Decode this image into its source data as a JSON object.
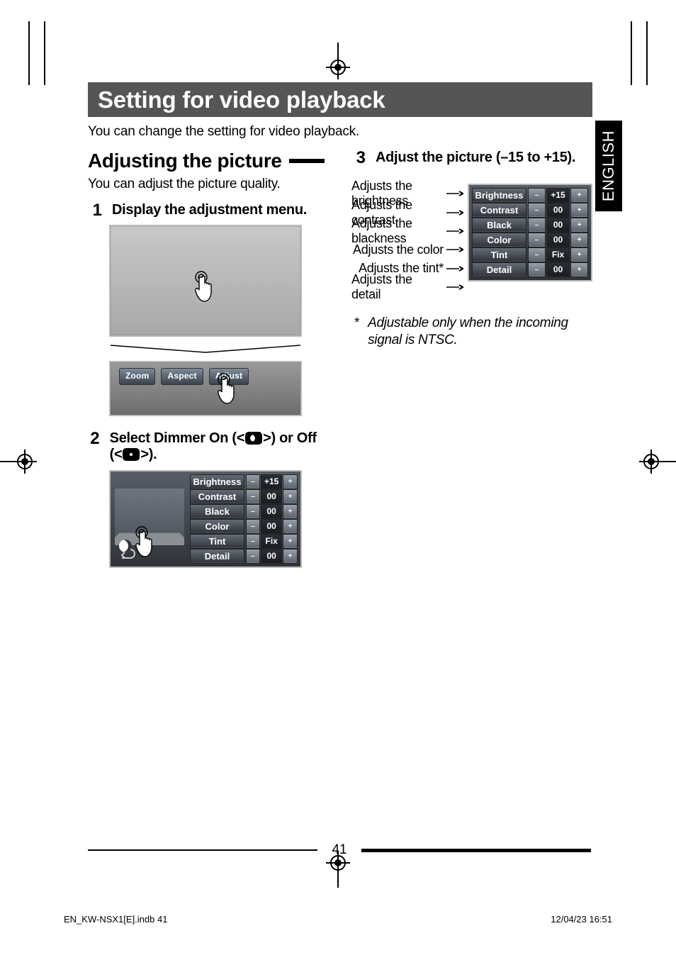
{
  "language_tab": "ENGLISH",
  "title": "Setting for video playback",
  "intro": "You can change the setting for video playback.",
  "section": {
    "heading": "Adjusting the picture",
    "desc": "You can adjust the picture quality."
  },
  "steps": {
    "s1": {
      "num": "1",
      "text": "Display the adjustment menu."
    },
    "s2": {
      "num": "2",
      "text_pre": "Select Dimmer On (<",
      "text_mid": ">) or Off (<",
      "text_post": ">)."
    },
    "s3": {
      "num": "3",
      "text": "Adjust the picture (–15 to +15)."
    }
  },
  "strip_menu": {
    "zoom": "Zoom",
    "aspect": "Aspect",
    "adjust": "Adjust"
  },
  "adjustments": {
    "items": [
      {
        "label": "Brightness",
        "value": "+15"
      },
      {
        "label": "Contrast",
        "value": "00"
      },
      {
        "label": "Black",
        "value": "00"
      },
      {
        "label": "Color",
        "value": "00"
      },
      {
        "label": "Tint",
        "value": "Fix"
      },
      {
        "label": "Detail",
        "value": "00"
      }
    ]
  },
  "right_callouts": {
    "items": [
      "Adjusts the brightness",
      "Adjusts the contrast",
      "Adjusts the blackness",
      "Adjusts the color",
      "Adjusts the tint*",
      "Adjusts the detail"
    ]
  },
  "note": {
    "ast": "*",
    "text": "Adjustable only when the incoming signal is NTSC."
  },
  "page_number": "41",
  "imprint": {
    "left": "EN_KW-NSX1[E].indb   41",
    "right": "12/04/23   16:51"
  }
}
